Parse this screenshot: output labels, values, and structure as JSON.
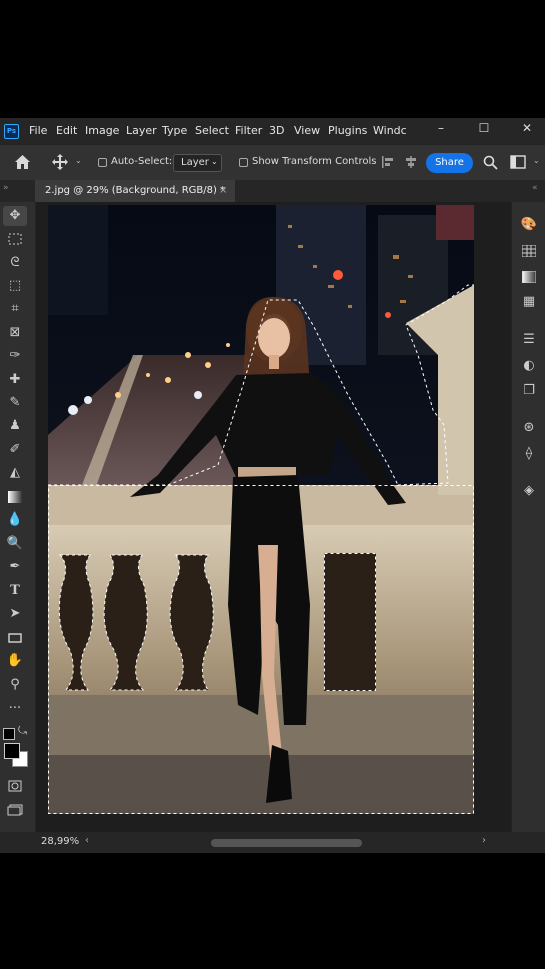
{
  "app": {
    "logo": "Ps"
  },
  "menu": {
    "items": [
      "File",
      "Edit",
      "Image",
      "Layer",
      "Type",
      "Select",
      "Filter",
      "3D",
      "View",
      "Plugins",
      "Windc"
    ]
  },
  "window_controls": {
    "minimize": "–",
    "maximize": "☐",
    "close": "✕"
  },
  "options": {
    "auto_select_label": "Auto-Select:",
    "auto_select_checked": false,
    "auto_select_target": "Layer",
    "show_transform_label": "Show Transform Controls",
    "show_transform_checked": false,
    "share_label": "Share"
  },
  "document": {
    "tab_title": "2.jpg @ 29% (Background, RGB/8) *",
    "close": "×"
  },
  "status": {
    "zoom": "28,99%"
  },
  "colors": {
    "accent": "#1473e6",
    "foreground": "#000000",
    "background": "#ffffff",
    "panel": "#2b2b2b"
  },
  "tools": [
    "move-tool-icon",
    "marquee-tool-icon",
    "lasso-tool-icon",
    "object-selection-tool-icon",
    "crop-tool-icon",
    "frame-tool-icon",
    "eyedropper-tool-icon",
    "healing-brush-icon",
    "brush-tool-icon",
    "clone-stamp-icon",
    "history-brush-icon",
    "eraser-tool-icon",
    "gradient-tool-icon",
    "blur-tool-icon",
    "dodge-tool-icon",
    "pen-tool-icon",
    "type-tool-icon",
    "path-selection-icon",
    "rectangle-tool-icon",
    "hand-tool-icon",
    "zoom-tool-icon",
    "more-tools-icon"
  ],
  "right_panels": [
    "color-panel-icon",
    "swatches-panel-icon",
    "gradients-panel-icon",
    "patterns-panel-icon",
    "adjustments-panel-icon",
    "properties-panel-icon",
    "libraries-panel-icon",
    "channels-panel-icon",
    "paths-panel-icon",
    "layers-panel-icon"
  ]
}
